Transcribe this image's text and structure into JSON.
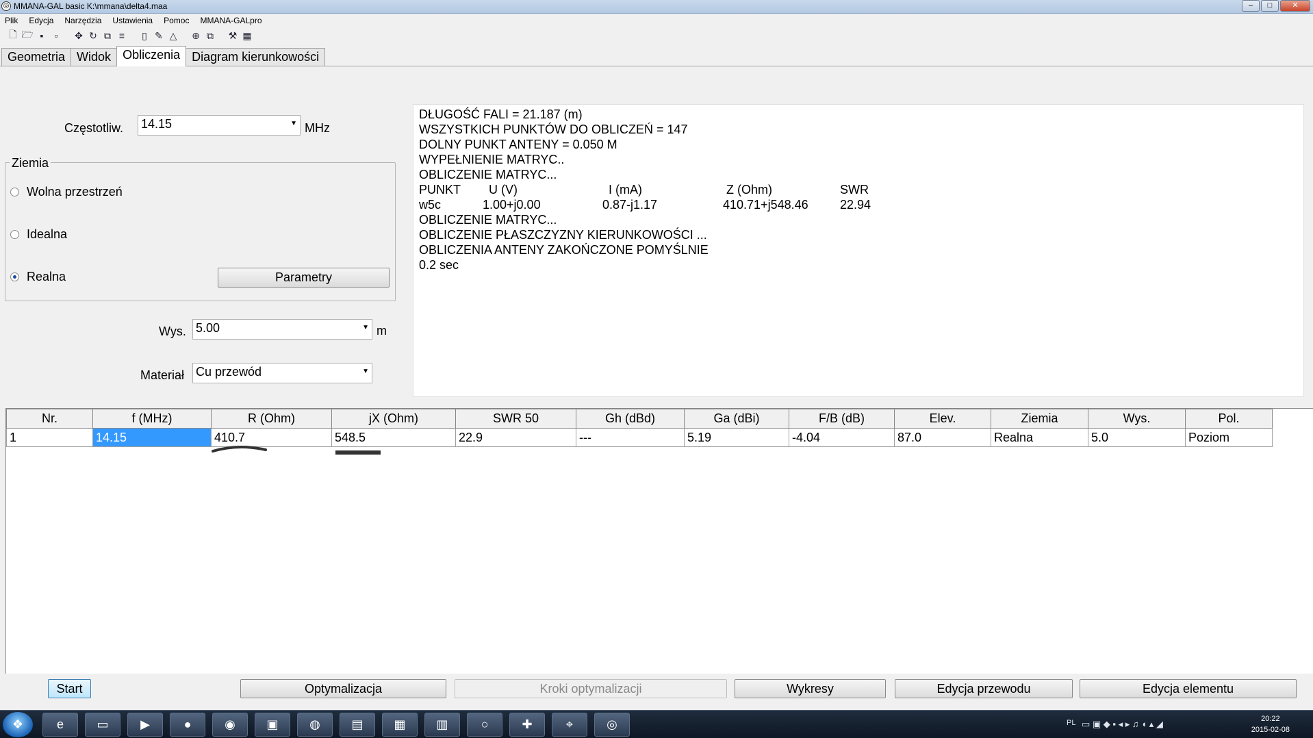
{
  "window": {
    "title": "MMANA-GAL basic K:\\mmana\\delta4.maa"
  },
  "menu": [
    "Plik",
    "Edycja",
    "Narzędzia",
    "Ustawienia",
    "Pomoc",
    "MMANA-GALpro"
  ],
  "toolbar_icons": [
    "new-file-icon",
    "open-folder-icon",
    "save-icon",
    "save-as-icon",
    "move-icon",
    "rotate-icon",
    "copy-icon",
    "align-icon",
    "page-icon",
    "edit-icon",
    "triangle-icon",
    "target-icon",
    "duplicate-icon",
    "tools-icon",
    "calculator-icon"
  ],
  "tabs": [
    "Geometria",
    "Widok",
    "Obliczenia",
    "Diagram kierunkowości"
  ],
  "active_tab": "Obliczenia",
  "freq": {
    "label": "Częstotliw.",
    "value": "14.15",
    "unit": "MHz"
  },
  "ground": {
    "legend": "Ziemia",
    "options": [
      "Wolna przestrzeń",
      "Idealna",
      "Realna"
    ],
    "selected": "Realna",
    "params_button": "Parametry"
  },
  "height": {
    "label": "Wys.",
    "value": "5.00",
    "unit": "m"
  },
  "material": {
    "label": "Materiał",
    "value": "Cu przewód"
  },
  "output": {
    "lines": [
      "DŁUGOŚĆ FALI = 21.187 (m)",
      "WSZYSTKICH PUNKTÓW DO OBLICZEŃ = 147",
      "DOLNY PUNKT ANTENY = 0.050 M",
      "WYPEŁNIENIE MATRYC..",
      "OBLICZENIE MATRYC..."
    ],
    "point_header": [
      "PUNKT",
      "U (V)",
      "I (mA)",
      "Z (Ohm)",
      "SWR"
    ],
    "point_row": [
      "w5c",
      "1.00+j0.00",
      "0.87-j1.17",
      "410.71+j548.46",
      "22.94"
    ],
    "lines_after": [
      "OBLICZENIE MATRYC...",
      "OBLICZENIE PŁASZCZYZNY KIERUNKOWOŚCI ...",
      "OBLICZENIA ANTENY ZAKOŃCZONE POMYŚLNIE",
      "0.2 sec"
    ]
  },
  "results_table": {
    "columns": [
      "Nr.",
      "f (MHz)",
      "R (Ohm)",
      "jX (Ohm)",
      "SWR 50",
      "Gh (dBd)",
      "Ga (dBi)",
      "F/B (dB)",
      "Elev.",
      "Ziemia",
      "Wys.",
      "Pol."
    ],
    "rows": [
      [
        "1",
        "14.15",
        "410.7",
        "548.5",
        "22.9",
        "---",
        "5.19",
        "-4.04",
        "87.0",
        "Realna",
        "5.0",
        "Poziom"
      ]
    ]
  },
  "buttons": {
    "start": "Start",
    "optimize": "Optymalizacja",
    "opt_steps": "Kroki optymalizacji",
    "plots": "Wykresy",
    "wire_edit": "Edycja przewodu",
    "element_edit": "Edycja elementu"
  },
  "taskbar": {
    "apps": [
      "ie-icon",
      "explorer-icon",
      "media-player-icon",
      "firefox-icon",
      "chrome-icon",
      "app-icon-1",
      "app-icon-2",
      "app-icon-3",
      "app-icon-4",
      "app-icon-5",
      "app-icon-6",
      "rtty-icon",
      "antenna-icon",
      "app-icon-7"
    ],
    "language": "PL",
    "time": "20:22",
    "date": "2015-02-08"
  }
}
